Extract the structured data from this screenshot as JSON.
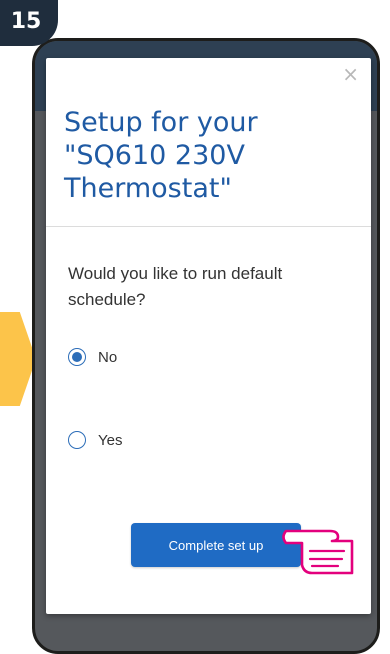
{
  "step": {
    "number": "15"
  },
  "modal": {
    "close_glyph": "×",
    "title": "Setup for your \"SQ610 230V Thermostat\"",
    "question": "Would you like to run default schedule?",
    "options": [
      {
        "label": "No",
        "selected": true
      },
      {
        "label": "Yes",
        "selected": false
      }
    ],
    "submit_label": "Complete set up"
  },
  "icons": {
    "close": "close-icon",
    "pointer": "hand-pointer-icon",
    "arrow": "arrow-shape"
  },
  "colors": {
    "title": "#1f5aa3",
    "button": "#1f6bc4",
    "radio": "#2c6db8",
    "badge": "#1f2d3d",
    "arrow": "#fcc44a",
    "hand_outline": "#e3007d"
  }
}
